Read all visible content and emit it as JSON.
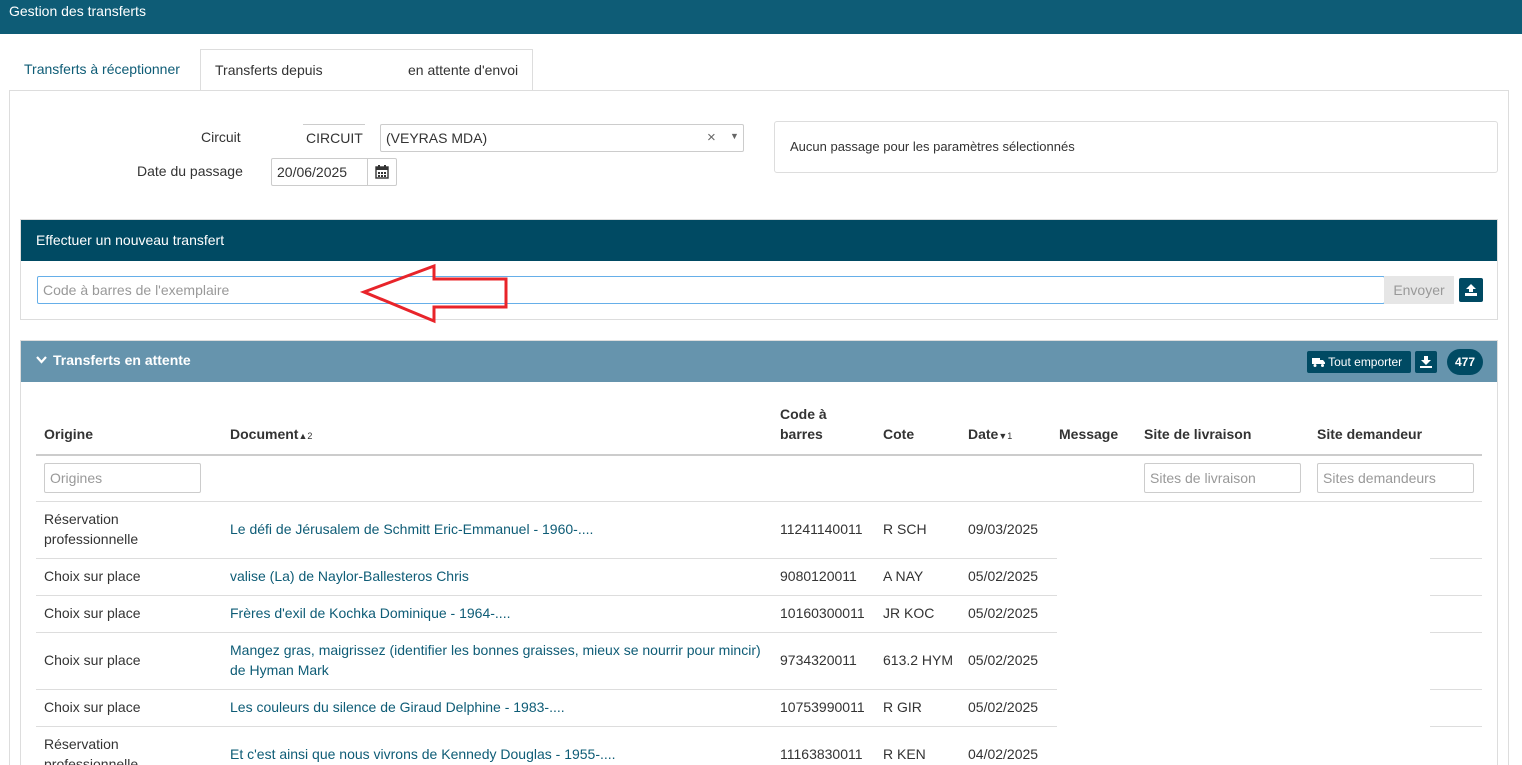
{
  "app": {
    "title": "Gestion des transferts"
  },
  "tabs": {
    "receive": "Transferts à réceptionner",
    "from_part1": "Transferts depuis",
    "from_part2": "en attente d'envoi"
  },
  "form": {
    "circuit_label": "Circuit",
    "circuit_code": "CIRCUIT",
    "circuit_value": "(VEYRAS MDA)",
    "clear_symbol": "×",
    "dropdown_symbol": "▼",
    "date_label": "Date du passage",
    "date_value": "20/06/2025",
    "info_message": "Aucun passage pour les paramètres sélectionnés"
  },
  "new_transfer": {
    "title": "Effectuer un nouveau transfert",
    "barcode_placeholder": "Code à barres de l'exemplaire",
    "send_label": "Envoyer"
  },
  "pending": {
    "title": "Transferts en attente",
    "export_label": "Tout emporter",
    "count": "477",
    "columns": {
      "origin": "Origine",
      "document": "Document",
      "document_sort": "2",
      "barcode_line1": "Code à",
      "barcode_line2": "barres",
      "cote": "Cote",
      "date": "Date",
      "date_sort": "1",
      "message": "Message",
      "delivery_site": "Site de livraison",
      "requester_site": "Site demandeur"
    },
    "filters": {
      "origins_placeholder": "Origines",
      "delivery_placeholder": "Sites de livraison",
      "requester_placeholder": "Sites demandeurs"
    },
    "rows": [
      {
        "origin_l1": "Réservation",
        "origin_l2": "professionnelle",
        "doc_l1": "Le défi de Jérusalem de Schmitt Eric-Emmanuel - 1960-....",
        "doc_l2": "",
        "barcode": "11241140011",
        "cote": "R SCH",
        "date": "09/03/2025"
      },
      {
        "origin_l1": "Choix sur place",
        "origin_l2": "",
        "doc_l1": "valise (La) de Naylor-Ballesteros Chris",
        "doc_l2": "",
        "barcode": "9080120011",
        "cote": "A NAY",
        "date": "05/02/2025"
      },
      {
        "origin_l1": "Choix sur place",
        "origin_l2": "",
        "doc_l1": "Frères d'exil de Kochka Dominique - 1964-....",
        "doc_l2": "",
        "barcode": "10160300011",
        "cote": "JR KOC",
        "date": "05/02/2025"
      },
      {
        "origin_l1": "Choix sur place",
        "origin_l2": "",
        "doc_l1": "Mangez gras, maigrissez (identifier les bonnes graisses, mieux se nourrir pour mincir)",
        "doc_l2": "de Hyman Mark",
        "barcode": "9734320011",
        "cote": "613.2 HYM",
        "date": "05/02/2025"
      },
      {
        "origin_l1": "Choix sur place",
        "origin_l2": "",
        "doc_l1": "Les couleurs du silence de Giraud Delphine - 1983-....",
        "doc_l2": "",
        "barcode": "10753990011",
        "cote": "R GIR",
        "date": "05/02/2025"
      },
      {
        "origin_l1": "Réservation",
        "origin_l2": "professionnelle",
        "doc_l1": "Et c'est ainsi que nous vivrons de Kennedy Douglas - 1955-....",
        "doc_l2": "",
        "barcode": "11163830011",
        "cote": "R KEN",
        "date": "04/02/2025"
      }
    ]
  },
  "colors": {
    "topbar": "#0e5c76",
    "section_header_dark": "#004a63",
    "section_header_light": "#6694ad",
    "link": "#0e5c76",
    "annotation_arrow": "#e8242a"
  }
}
